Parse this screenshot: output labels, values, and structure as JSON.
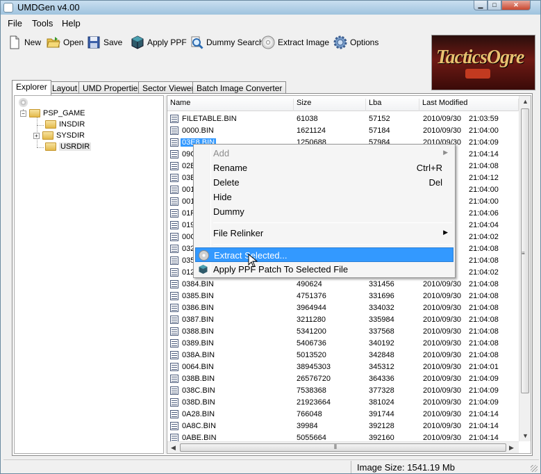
{
  "window": {
    "title": "UMDGen v4.00"
  },
  "menu": [
    "File",
    "Tools",
    "Help"
  ],
  "toolbar": {
    "new": "New",
    "open": "Open",
    "save": "Save",
    "apply_ppf": "Apply PPF",
    "dummy_search": "Dummy Search",
    "extract_image": "Extract Image",
    "options": "Options"
  },
  "logo": {
    "text": "TacticsOgre"
  },
  "tabs": [
    "Explorer",
    "Layout",
    "UMD Properties",
    "Sector Viewer",
    "Batch Image Converter"
  ],
  "tree": {
    "root": "PSP_GAME",
    "children": [
      "INSDIR",
      "SYSDIR",
      "USRDIR"
    ]
  },
  "list": {
    "columns": [
      "Name",
      "Size",
      "Lba",
      "Last Modified"
    ],
    "rows": [
      {
        "name": "FILETABLE.BIN",
        "size": "61038",
        "lba": "57152",
        "date": "2010/09/30",
        "time": "21:03:59"
      },
      {
        "name": "0000.BIN",
        "size": "1621124",
        "lba": "57184",
        "date": "2010/09/30",
        "time": "21:04:00"
      },
      {
        "name": "03E8.BIN",
        "size": "1250688",
        "lba": "57984",
        "date": "2010/09/30",
        "time": "21:04:09",
        "selected": true
      },
      {
        "name": "09C4",
        "size": "",
        "lba": "",
        "date": "",
        "time": "21:04:14"
      },
      {
        "name": "02BC",
        "size": "",
        "lba": "",
        "date": "",
        "time": "21:04:08"
      },
      {
        "name": "03E9",
        "size": "",
        "lba": "",
        "date": "",
        "time": "21:04:12"
      },
      {
        "name": "0014",
        "size": "",
        "lba": "",
        "date": "",
        "time": "21:04:00"
      },
      {
        "name": "001E",
        "size": "",
        "lba": "",
        "date": "",
        "time": "21:04:00"
      },
      {
        "name": "01F4",
        "size": "",
        "lba": "",
        "date": "",
        "time": "21:04:06"
      },
      {
        "name": "0190",
        "size": "",
        "lba": "",
        "date": "",
        "time": "21:04:04"
      },
      {
        "name": "00C8",
        "size": "",
        "lba": "",
        "date": "",
        "time": "21:04:02"
      },
      {
        "name": "0320",
        "size": "",
        "lba": "",
        "date": "",
        "time": "21:04:08"
      },
      {
        "name": "0352",
        "size": "",
        "lba": "",
        "date": "",
        "time": "21:04:08"
      },
      {
        "name": "0120",
        "size": "",
        "lba": "",
        "date": "",
        "time": "21:04:02"
      },
      {
        "name": "0384.BIN",
        "size": "490624",
        "lba": "331456",
        "date": "2010/09/30",
        "time": "21:04:08"
      },
      {
        "name": "0385.BIN",
        "size": "4751376",
        "lba": "331696",
        "date": "2010/09/30",
        "time": "21:04:08"
      },
      {
        "name": "0386.BIN",
        "size": "3964944",
        "lba": "334032",
        "date": "2010/09/30",
        "time": "21:04:08"
      },
      {
        "name": "0387.BIN",
        "size": "3211280",
        "lba": "335984",
        "date": "2010/09/30",
        "time": "21:04:08"
      },
      {
        "name": "0388.BIN",
        "size": "5341200",
        "lba": "337568",
        "date": "2010/09/30",
        "time": "21:04:08"
      },
      {
        "name": "0389.BIN",
        "size": "5406736",
        "lba": "340192",
        "date": "2010/09/30",
        "time": "21:04:08"
      },
      {
        "name": "038A.BIN",
        "size": "5013520",
        "lba": "342848",
        "date": "2010/09/30",
        "time": "21:04:08"
      },
      {
        "name": "0064.BIN",
        "size": "38945303",
        "lba": "345312",
        "date": "2010/09/30",
        "time": "21:04:01"
      },
      {
        "name": "038B.BIN",
        "size": "26576720",
        "lba": "364336",
        "date": "2010/09/30",
        "time": "21:04:09"
      },
      {
        "name": "038C.BIN",
        "size": "7538368",
        "lba": "377328",
        "date": "2010/09/30",
        "time": "21:04:09"
      },
      {
        "name": "038D.BIN",
        "size": "21923664",
        "lba": "381024",
        "date": "2010/09/30",
        "time": "21:04:09"
      },
      {
        "name": "0A28.BIN",
        "size": "766048",
        "lba": "391744",
        "date": "2010/09/30",
        "time": "21:04:14"
      },
      {
        "name": "0A8C.BIN",
        "size": "39984",
        "lba": "392128",
        "date": "2010/09/30",
        "time": "21:04:14"
      },
      {
        "name": "0ABE.BIN",
        "size": "5055664",
        "lba": "392160",
        "date": "2010/09/30",
        "time": "21:04:14"
      }
    ]
  },
  "context_menu": {
    "add": "Add",
    "rename": "Rename",
    "rename_shortcut": "Ctrl+R",
    "delete": "Delete",
    "delete_shortcut": "Del",
    "hide": "Hide",
    "dummy": "Dummy",
    "file_relinker": "File Relinker",
    "extract_selected": "Extract Selected...",
    "apply_ppf_patch": "Apply PPF Patch To Selected File"
  },
  "status": {
    "image_size": "Image Size: 1541.19 Mb"
  }
}
